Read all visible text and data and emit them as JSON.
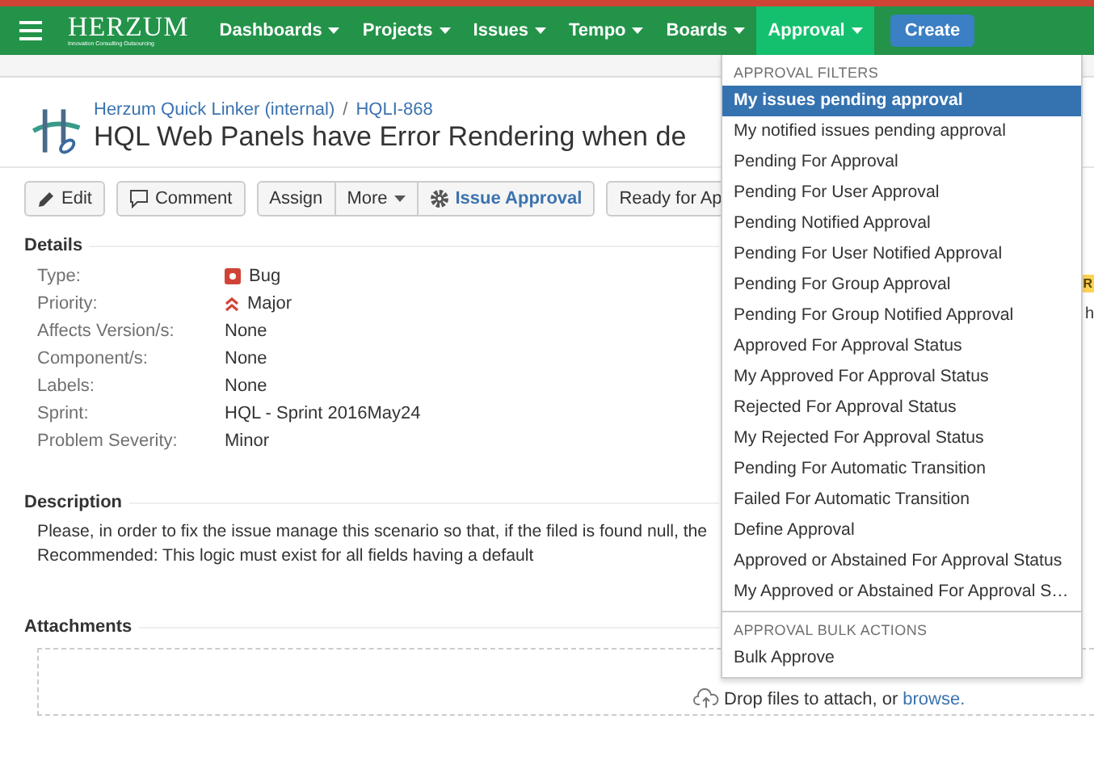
{
  "nav": {
    "logo": "HERZUM",
    "logo_tagline": "Innovation Consulting Outsourcing",
    "items": [
      {
        "label": "Dashboards",
        "selected": false
      },
      {
        "label": "Projects",
        "selected": false
      },
      {
        "label": "Issues",
        "selected": false
      },
      {
        "label": "Tempo",
        "selected": false
      },
      {
        "label": "Boards",
        "selected": false
      },
      {
        "label": "Approval",
        "selected": true
      }
    ],
    "create": "Create"
  },
  "issue": {
    "project": "Herzum Quick Linker (internal)",
    "separator": "/",
    "key": "HQLI-868",
    "title": "HQL Web Panels have Error Rendering when de"
  },
  "toolbar": [
    "Edit",
    "Comment",
    "Assign",
    "More",
    "Issue Approval",
    "Ready for Ap"
  ],
  "details": {
    "heading": "Details",
    "rows": [
      {
        "label": "Type:",
        "value": "Bug"
      },
      {
        "label": "Priority:",
        "value": "Major"
      },
      {
        "label": "Affects Version/s:",
        "value": "None"
      },
      {
        "label": "Component/s:",
        "value": "None"
      },
      {
        "label": "Labels:",
        "value": "None"
      },
      {
        "label": "Sprint:",
        "value": "HQL - Sprint 2016May24"
      },
      {
        "label": "Problem Severity:",
        "value": "Minor"
      }
    ]
  },
  "side_fragments": {
    "badge": "R",
    "text": "h"
  },
  "description": {
    "heading": "Description",
    "lines": [
      "Please, in order to fix the issue manage this scenario so that, if the filed is found null, the",
      "Recommended: This logic must exist for all fields having a default"
    ]
  },
  "attachments": {
    "heading": "Attachments",
    "drop_text": "Drop files to attach, or",
    "browse": "browse."
  },
  "menu": {
    "sections": [
      {
        "heading": "APPROVAL FILTERS",
        "items": [
          {
            "label": "My issues pending approval",
            "selected": true
          },
          {
            "label": "My notified issues pending approval",
            "selected": false
          },
          {
            "label": "Pending For Approval",
            "selected": false
          },
          {
            "label": "Pending For User Approval",
            "selected": false
          },
          {
            "label": "Pending Notified Approval",
            "selected": false
          },
          {
            "label": "Pending For User Notified Approval",
            "selected": false
          },
          {
            "label": "Pending For Group Approval",
            "selected": false
          },
          {
            "label": "Pending For Group Notified Approval",
            "selected": false
          },
          {
            "label": "Approved For Approval Status",
            "selected": false
          },
          {
            "label": "My Approved For Approval Status",
            "selected": false
          },
          {
            "label": "Rejected For Approval Status",
            "selected": false
          },
          {
            "label": "My Rejected For Approval Status",
            "selected": false
          },
          {
            "label": "Pending For Automatic Transition",
            "selected": false
          },
          {
            "label": "Failed For Automatic Transition",
            "selected": false
          },
          {
            "label": "Define Approval",
            "selected": false
          },
          {
            "label": "Approved or Abstained For Approval Status",
            "selected": false
          },
          {
            "label": "My Approved or Abstained For Approval S…",
            "selected": false
          }
        ]
      },
      {
        "heading": "APPROVAL BULK ACTIONS",
        "items": [
          {
            "label": "Bulk Approve",
            "selected": false
          }
        ]
      }
    ]
  }
}
